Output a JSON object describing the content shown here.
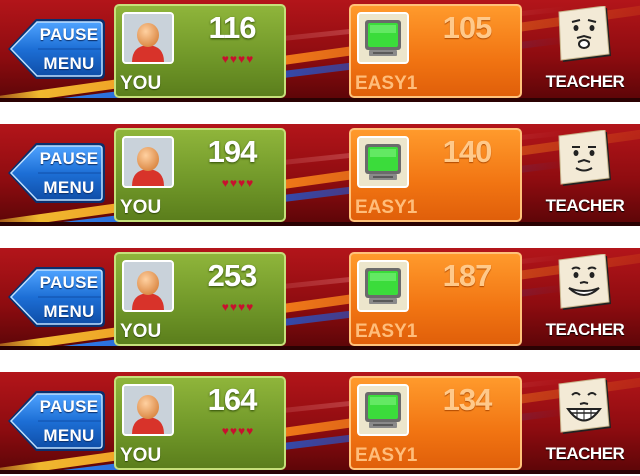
{
  "hud_frames": [
    {
      "pause": {
        "line1": "PAUSE",
        "line2": "MENU"
      },
      "player": {
        "score": "116",
        "name": "YOU"
      },
      "opponent": {
        "score": "105",
        "name": "EASY1"
      },
      "teacher": {
        "label": "TEACHER",
        "mood": "worried"
      }
    },
    {
      "pause": {
        "line1": "PAUSE",
        "line2": "MENU"
      },
      "player": {
        "score": "194",
        "name": "YOU"
      },
      "opponent": {
        "score": "140",
        "name": "EASY1"
      },
      "teacher": {
        "label": "TEACHER",
        "mood": "neutral"
      }
    },
    {
      "pause": {
        "line1": "PAUSE",
        "line2": "MENU"
      },
      "player": {
        "score": "253",
        "name": "YOU"
      },
      "opponent": {
        "score": "187",
        "name": "EASY1"
      },
      "teacher": {
        "label": "TEACHER",
        "mood": "smiling"
      }
    },
    {
      "pause": {
        "line1": "PAUSE",
        "line2": "MENU"
      },
      "player": {
        "score": "164",
        "name": "YOU"
      },
      "opponent": {
        "score": "134",
        "name": "EASY1"
      },
      "teacher": {
        "label": "TEACHER",
        "mood": "laughing"
      }
    }
  ],
  "lives_hearts": 4,
  "colors": {
    "player_panel": "#7aa12f",
    "opponent_panel": "#f27b17",
    "hud_background": "#a31318",
    "pause_button": "#1d6fd6",
    "hearts": "#c8102e"
  },
  "icons": {
    "player_avatar": "person-avatar-icon",
    "opponent_avatar": "computer-monitor-icon",
    "pause": "back-arrow-icon",
    "teacher": "paper-face-icon"
  }
}
